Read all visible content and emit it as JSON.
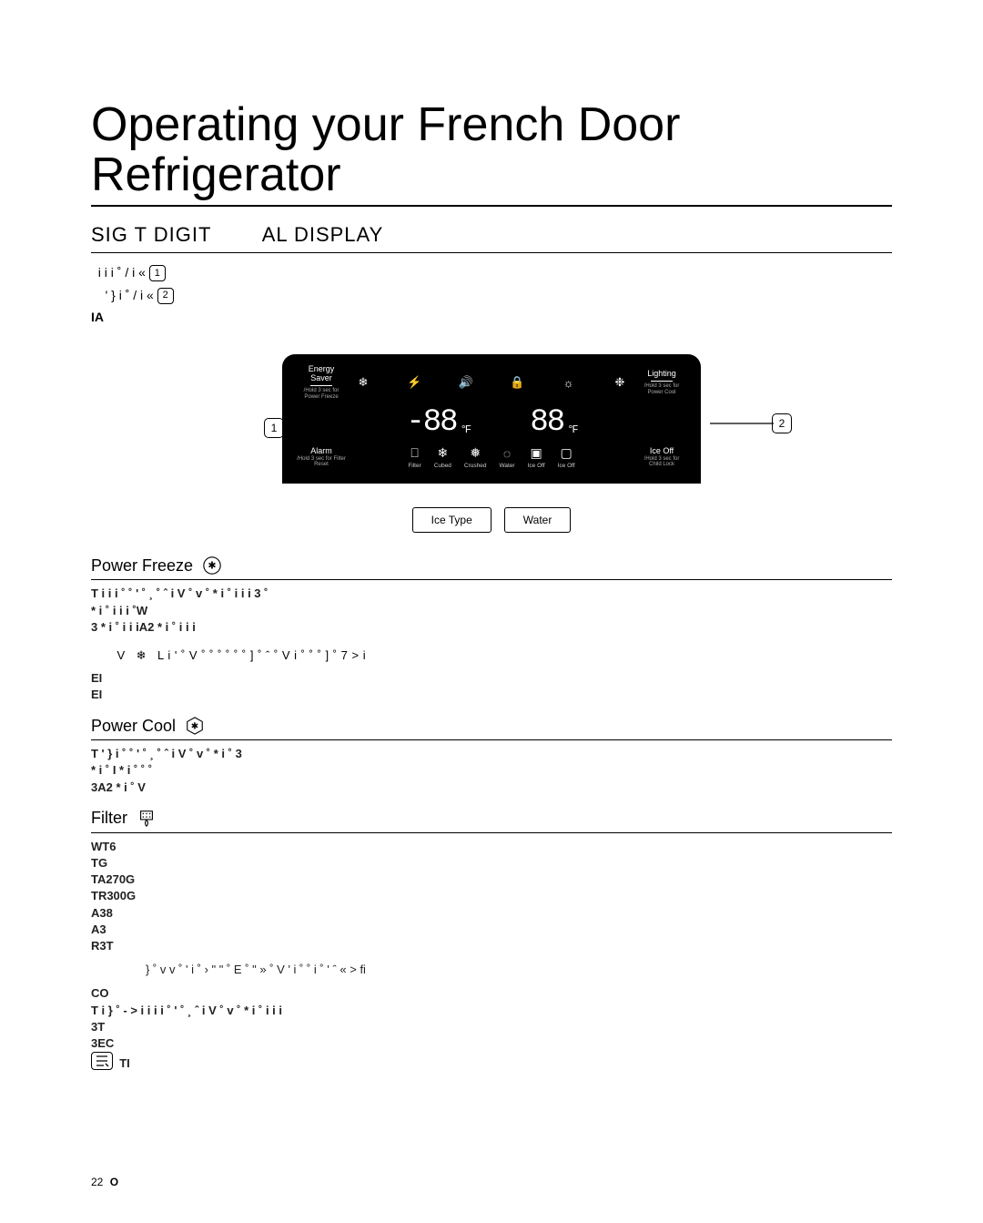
{
  "title": "Operating your French Door Refrigerator",
  "subheader_left": "SIG T DIGIT",
  "subheader_right": "AL DISPLAY",
  "intro": {
    "line1_pre": "i i  i  ˚ / i   «",
    "line1_num": "1",
    "line2_pre": "' } i ˚ / i   «",
    "line2_num": "2",
    "line3": "IA"
  },
  "panel": {
    "left_label": "Energy Saver",
    "left_sub": "/Hold 3 sec for Power Freeze",
    "right_label": "Lighting",
    "right_sub": "/Hold 3 sec for Power Cool",
    "alarm_label": "Alarm",
    "alarm_sub": "/Hold 3 sec for Filter Reset",
    "iceoff_label": "Ice Off",
    "iceoff_sub": "/Hold 3 sec for Child Lock",
    "temp1": "-88",
    "temp2": "88",
    "unit": "°F",
    "bottom_icons": [
      {
        "glyph": "⎕",
        "label": "Filter"
      },
      {
        "glyph": "❄",
        "label": "Cubed"
      },
      {
        "glyph": "❅",
        "label": "Crushed"
      },
      {
        "glyph": "◌",
        "label": "Water"
      },
      {
        "glyph": "▣",
        "label": "Ice Off"
      },
      {
        "glyph": "▢",
        "label": "Ice Off"
      }
    ],
    "pills": [
      "Ice Type",
      "Water"
    ],
    "callout_left": "1",
    "callout_right": "2"
  },
  "power_freeze": {
    "title": "Power Freeze",
    "p1": "T   i i i  ˚  ˚    ' ˚ ¸ ˚ ˆ i V ˚ v    ˚ *   i  ˚    i i i  3 ˚",
    "p2": " *   i  ˚    i i  i ˚W ",
    "p3": "3 *   i  ˚    i i  iA2 *   i  ˚    i i i",
    "caution": "L i ' ˚   V  ˚ ˚ ˚ ˚ ˚ ˚ ] ˚       ˆ     ˚   V i ˚     ˚ ˚ ] ˚ 7 >   i",
    "p4a": "EI",
    "p4b": "EI"
  },
  "power_cool": {
    "title": "Power Cool",
    "p1": "T     ' } i ˚  ˚     ' ˚ ¸ ˚ ˆ i V ˚ v    ˚ *   i  ˚       3",
    "p2": " *   i  ˚     I *    i  ˚ ˚   ˚",
    "p3": "3A2 *   i  ˚ V"
  },
  "filter": {
    "title": "Filter",
    "l1": "WT6",
    "l2": "TG",
    "l3": "TA270G",
    "l4": "TR300G",
    "l5": "A38",
    "l6": "A3",
    "l7": "R3T",
    "row": "}  ˚    v v ˚      ' i ˚ › \" \"    ˚ E  ˚ \"    »  ˚ V   ' i ˚     ˚     i ˚ '   ˆ  «   >   fi",
    "c1": "CO",
    "c2": "T   i  }  ˚ - >  i    i i i   ˚     ' ˚ ¸ ˆ i V ˚ v    ˚ *   i  ˚    i i i",
    "c3": "3T",
    "c4": "3EC",
    "note": "TI"
  },
  "footer": {
    "page": "22",
    "text": "O"
  }
}
